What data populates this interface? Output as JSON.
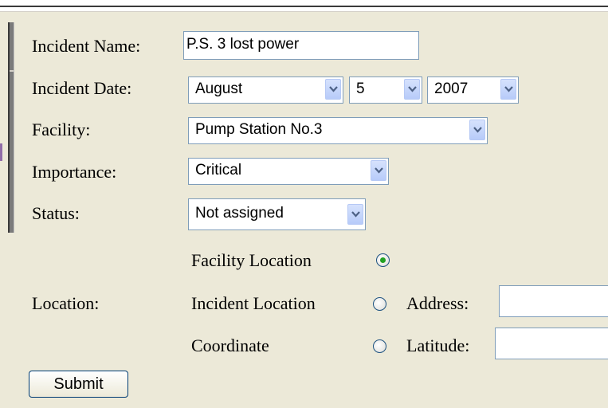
{
  "form": {
    "incident_name": {
      "label": "Incident Name:",
      "value": "P.S. 3 lost power"
    },
    "incident_date": {
      "label": "Incident Date:",
      "month": "August",
      "day": "5",
      "year": "2007"
    },
    "facility": {
      "label": "Facility:",
      "value": "Pump Station No.3"
    },
    "importance": {
      "label": "Importance:",
      "value": "Critical"
    },
    "status": {
      "label": "Status:",
      "value": "Not assigned"
    },
    "location": {
      "label": "Location:",
      "options": [
        {
          "label": "Facility Location",
          "checked": true
        },
        {
          "label": "Incident Location",
          "checked": false,
          "field_label": "Address:",
          "field_value": ""
        },
        {
          "label": "Coordinate",
          "checked": false,
          "field_label": "Latitude:",
          "field_value": ""
        }
      ]
    },
    "submit_label": "Submit"
  },
  "icons": {
    "dropdown": "chevron-down-icon"
  },
  "colors": {
    "background": "#ece9d8",
    "field_border": "#7f9db9",
    "radio_checked": "#21a121",
    "dropdown_button": "#c3d3fb"
  }
}
